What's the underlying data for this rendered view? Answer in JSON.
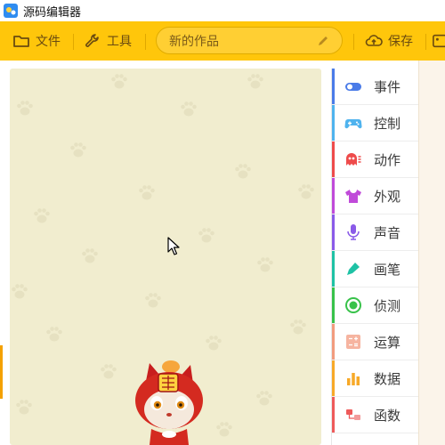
{
  "window": {
    "title": "源码编辑器"
  },
  "toolbar": {
    "file_label": "文件",
    "tools_label": "工具",
    "project_name": "新的作品",
    "save_label": "保存"
  },
  "categories": [
    {
      "label": "事件",
      "color": "#4a7be8"
    },
    {
      "label": "控制",
      "color": "#4fb3ee"
    },
    {
      "label": "动作",
      "color": "#ee4b4b"
    },
    {
      "label": "外观",
      "color": "#c04ad9"
    },
    {
      "label": "声音",
      "color": "#8a5ae8"
    },
    {
      "label": "画笔",
      "color": "#1ec2a5"
    },
    {
      "label": "侦测",
      "color": "#38c24a"
    },
    {
      "label": "运算",
      "color": "#f29b7e"
    },
    {
      "label": "数据",
      "color": "#f7a928"
    },
    {
      "label": "函数",
      "color": "#ee5a5a"
    }
  ],
  "colors": {
    "toolbar_bg": "#ffc60b",
    "stage_bg": "#f1edcf"
  }
}
